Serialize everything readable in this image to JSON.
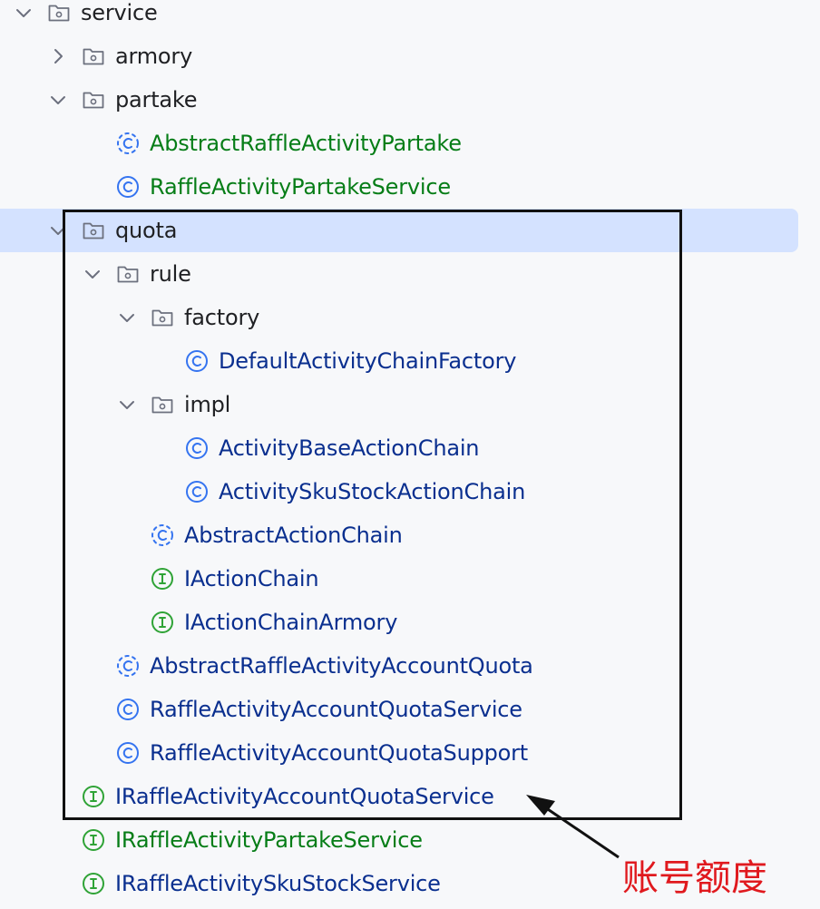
{
  "tree": {
    "rows": [
      {
        "label": "service",
        "kind": "folder",
        "state": "expanded",
        "depth": 0,
        "text_color": "folder"
      },
      {
        "label": "armory",
        "kind": "folder",
        "state": "collapsed",
        "depth": 1,
        "text_color": "folder"
      },
      {
        "label": "partake",
        "kind": "folder",
        "state": "expanded",
        "depth": 1,
        "text_color": "folder"
      },
      {
        "label": "AbstractRaffleActivityPartake",
        "kind": "abstract-class",
        "depth": 2,
        "text_color": "green"
      },
      {
        "label": "RaffleActivityPartakeService",
        "kind": "class",
        "depth": 2,
        "text_color": "green"
      },
      {
        "label": "quota",
        "kind": "folder",
        "state": "expanded",
        "depth": 1,
        "text_color": "folder",
        "selected": true
      },
      {
        "label": "rule",
        "kind": "folder",
        "state": "expanded",
        "depth": 2,
        "text_color": "folder"
      },
      {
        "label": "factory",
        "kind": "folder",
        "state": "expanded",
        "depth": 3,
        "text_color": "folder"
      },
      {
        "label": "DefaultActivityChainFactory",
        "kind": "class",
        "depth": 4,
        "text_color": "blue"
      },
      {
        "label": "impl",
        "kind": "folder",
        "state": "expanded",
        "depth": 3,
        "text_color": "folder"
      },
      {
        "label": "ActivityBaseActionChain",
        "kind": "class",
        "depth": 4,
        "text_color": "blue"
      },
      {
        "label": "ActivitySkuStockActionChain",
        "kind": "class",
        "depth": 4,
        "text_color": "blue"
      },
      {
        "label": "AbstractActionChain",
        "kind": "abstract-class",
        "depth": 3,
        "text_color": "blue"
      },
      {
        "label": "IActionChain",
        "kind": "interface",
        "depth": 3,
        "text_color": "blue"
      },
      {
        "label": "IActionChainArmory",
        "kind": "interface",
        "depth": 3,
        "text_color": "blue"
      },
      {
        "label": "AbstractRaffleActivityAccountQuota",
        "kind": "abstract-class",
        "depth": 2,
        "text_color": "blue"
      },
      {
        "label": "RaffleActivityAccountQuotaService",
        "kind": "class",
        "depth": 2,
        "text_color": "blue"
      },
      {
        "label": "RaffleActivityAccountQuotaSupport",
        "kind": "class",
        "depth": 2,
        "text_color": "blue"
      },
      {
        "label": "IRaffleActivityAccountQuotaService",
        "kind": "interface",
        "depth": 1,
        "text_color": "blue"
      },
      {
        "label": "IRaffleActivityPartakeService",
        "kind": "interface",
        "depth": 1,
        "text_color": "green"
      },
      {
        "label": "IRaffleActivitySkuStockService",
        "kind": "interface",
        "depth": 1,
        "text_color": "blue"
      }
    ]
  },
  "annotation": {
    "text": "账号额度",
    "color": "#e0191e"
  },
  "colors": {
    "selection": "#d4e2ff",
    "class_icon": "#3574f0",
    "interface_icon": "#2fa336",
    "green_text": "#067d17",
    "blue_text": "#0a2f8f"
  }
}
